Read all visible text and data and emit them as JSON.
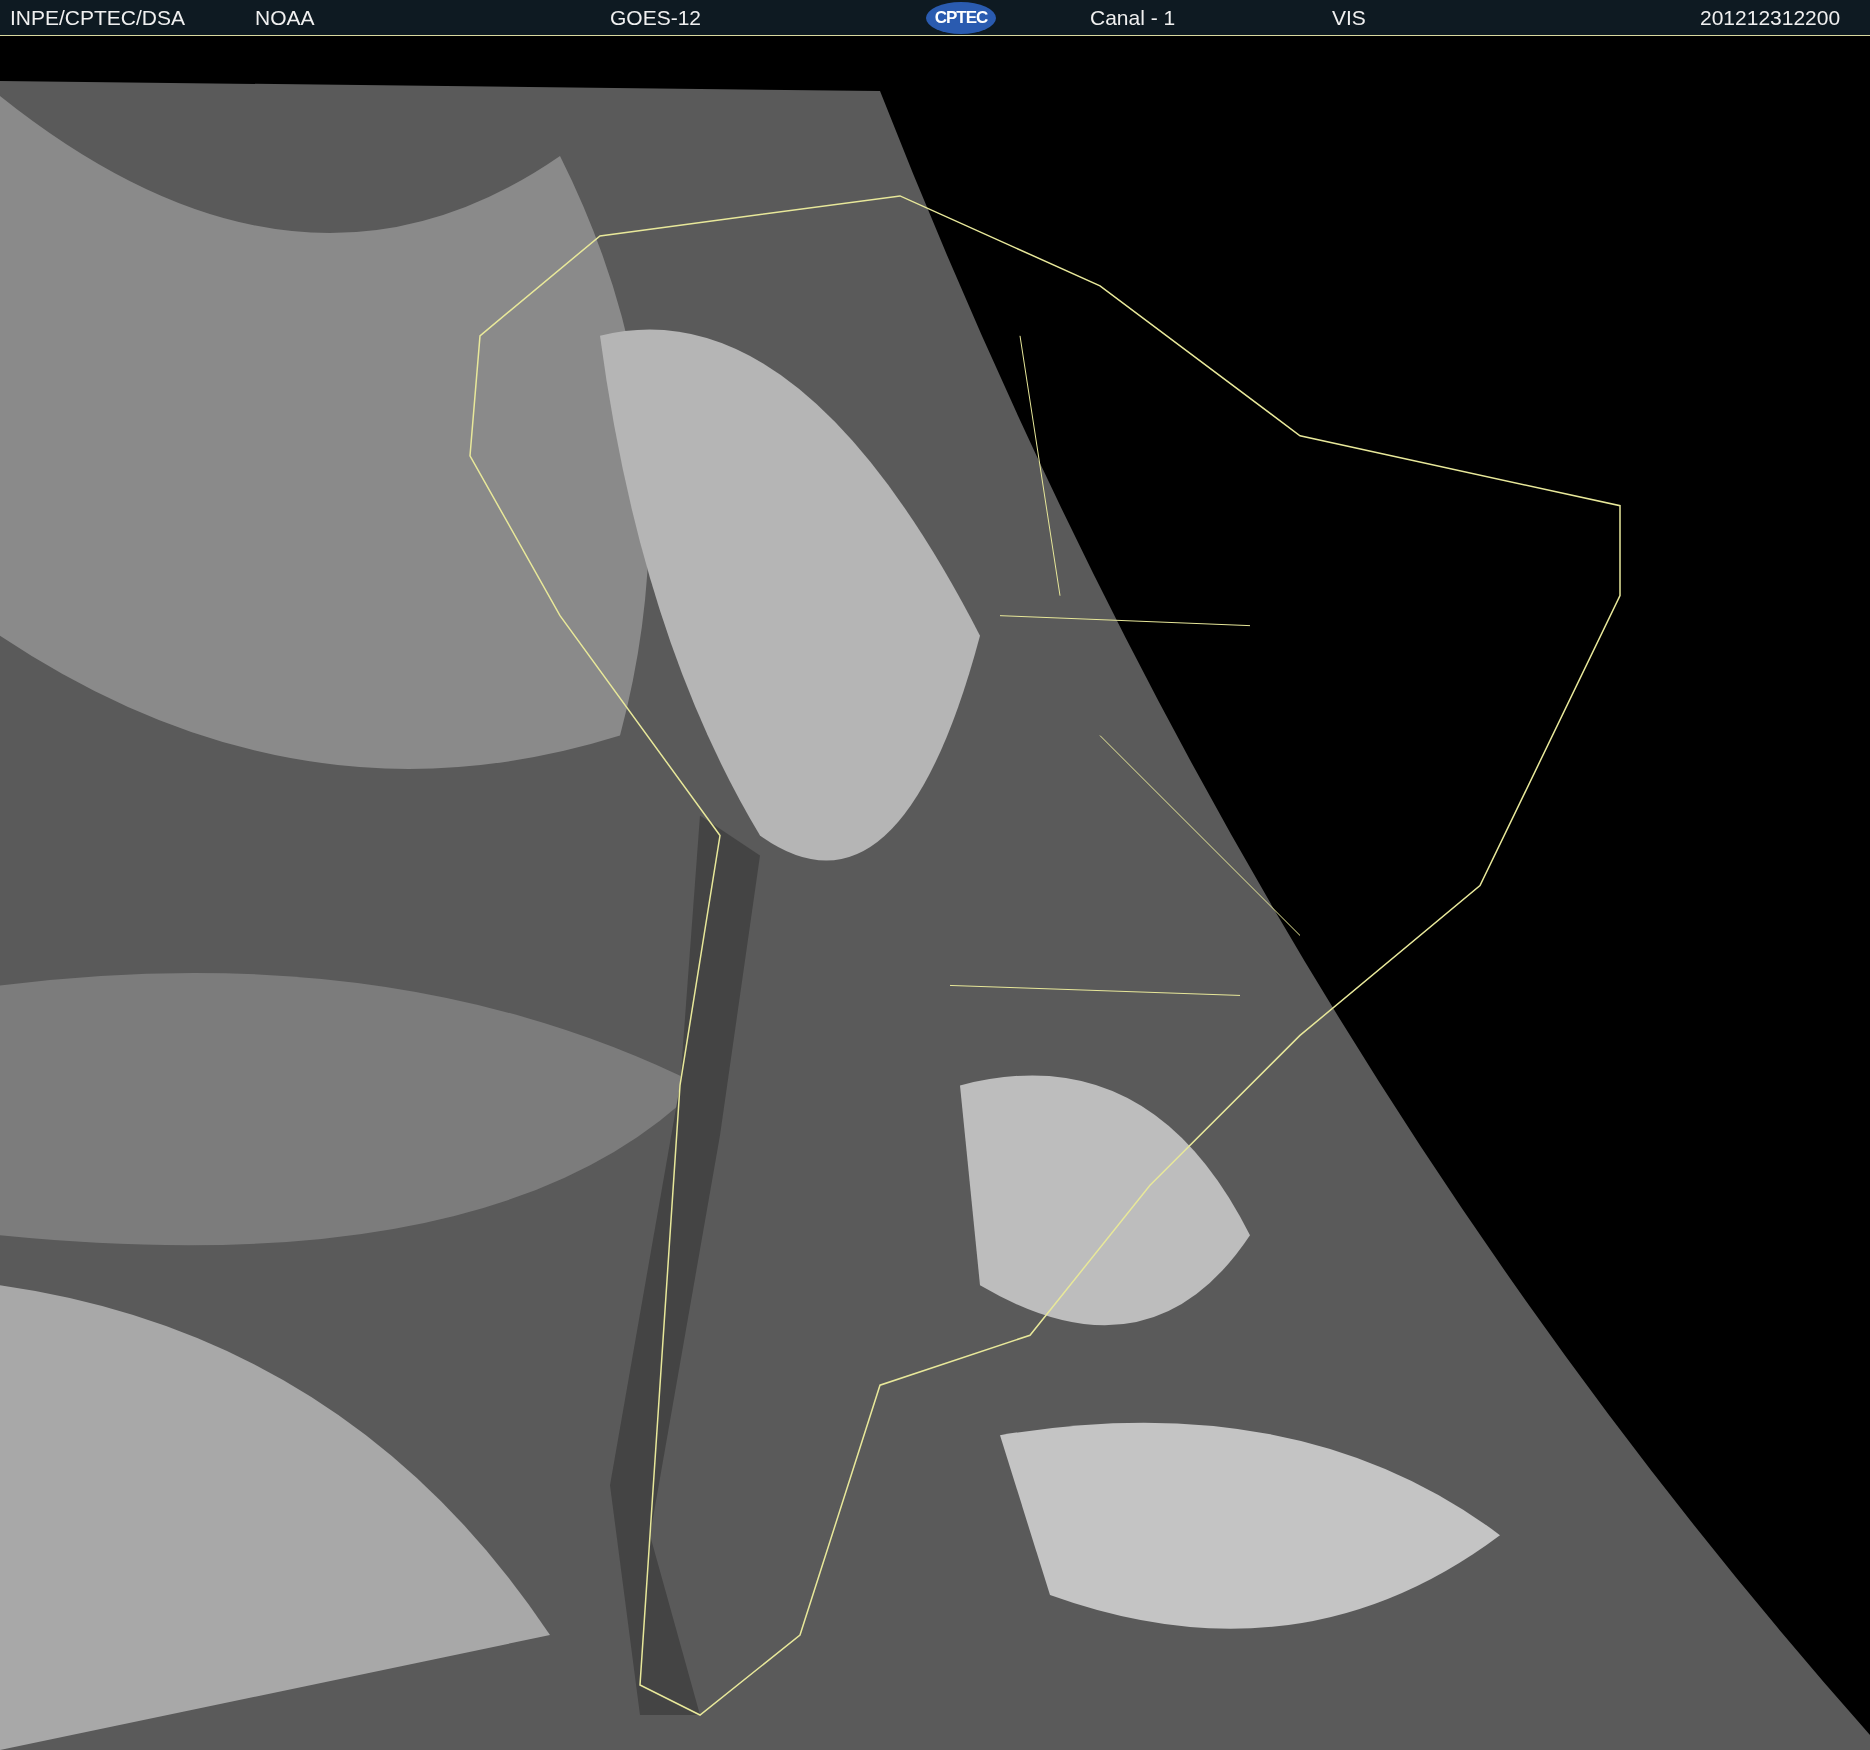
{
  "header": {
    "source": "INPE/CPTEC/DSA",
    "agency": "NOAA",
    "satellite": "GOES-12",
    "logo": "CPTEC",
    "channel": "Canal - 1",
    "band": "VIS",
    "timestamp": "201212312200"
  }
}
